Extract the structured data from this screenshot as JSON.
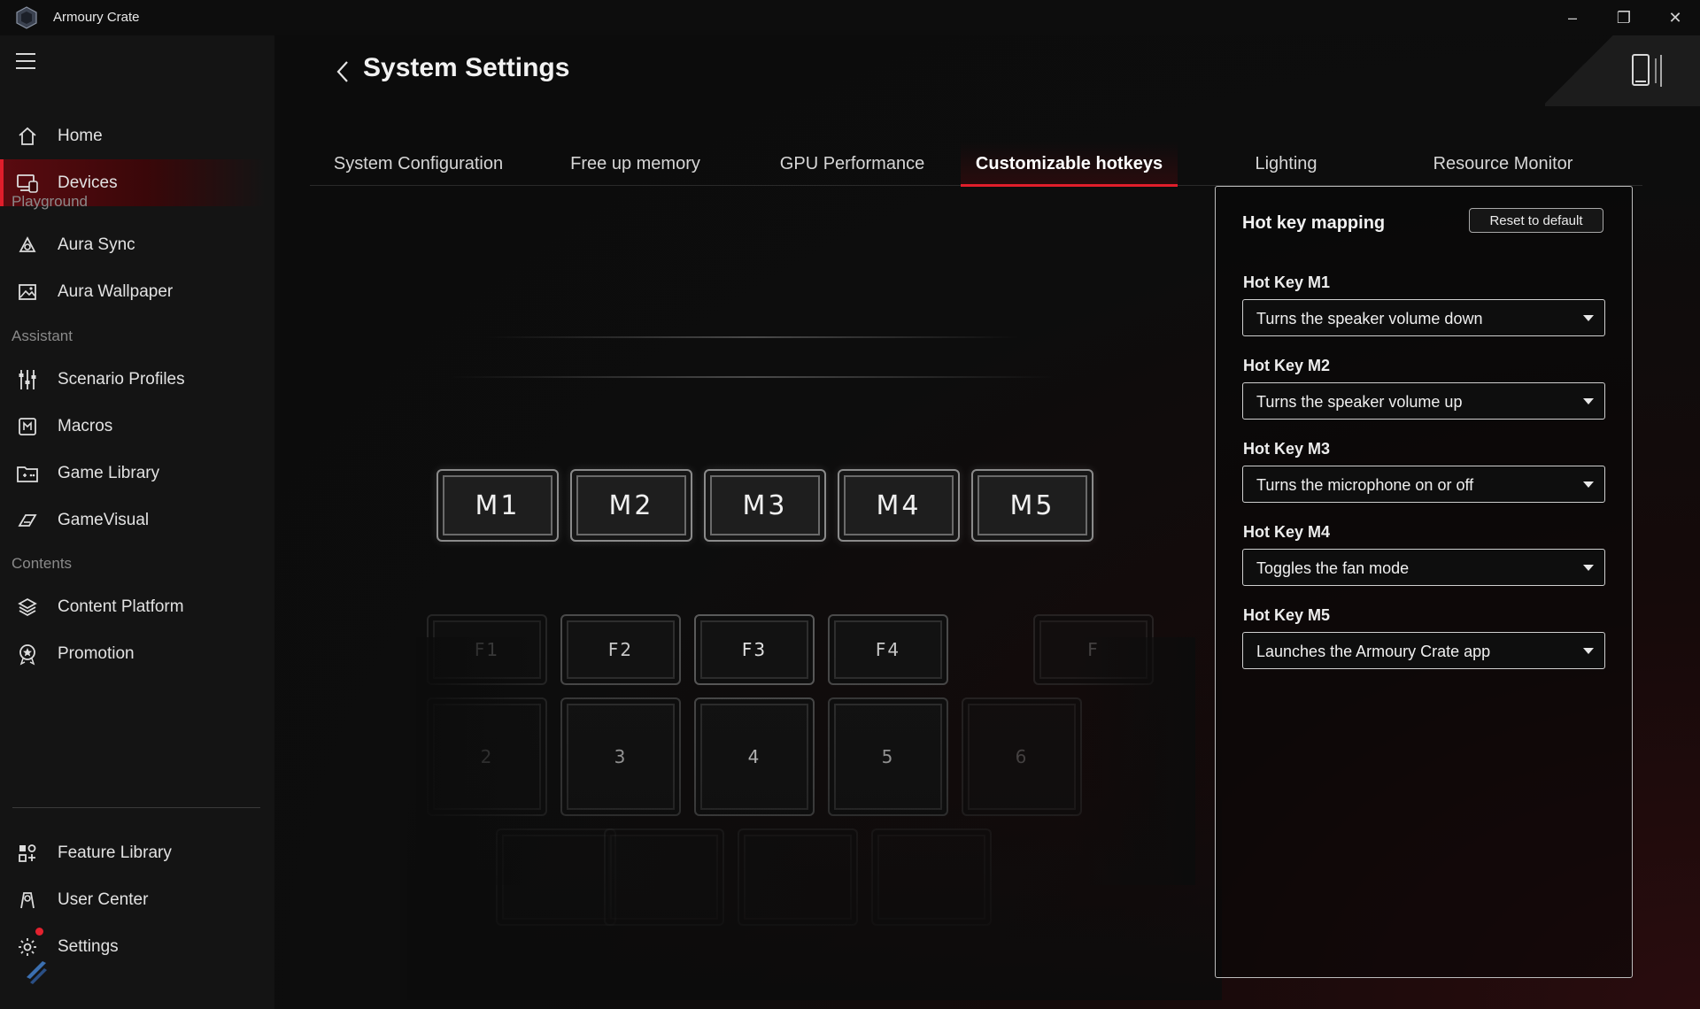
{
  "window": {
    "title": "Armoury Crate",
    "minimize": "–",
    "maximize": "❐",
    "close": "✕"
  },
  "sidebar": {
    "items": [
      {
        "label": "Home",
        "icon": "home-icon"
      },
      {
        "label": "Devices",
        "icon": "devices-icon",
        "active": true
      }
    ],
    "sections": {
      "playground": "Playground",
      "assistant": "Assistant",
      "contents": "Contents"
    },
    "playground_items": [
      {
        "label": "Aura Sync",
        "icon": "aura-sync-icon"
      },
      {
        "label": "Aura Wallpaper",
        "icon": "wallpaper-icon"
      }
    ],
    "assistant_items": [
      {
        "label": "Scenario Profiles",
        "icon": "sliders-icon"
      },
      {
        "label": "Macros",
        "icon": "macro-icon"
      },
      {
        "label": "Game Library",
        "icon": "game-library-icon"
      },
      {
        "label": "GameVisual",
        "icon": "gamevisual-icon"
      }
    ],
    "contents_items": [
      {
        "label": "Content Platform",
        "icon": "layers-icon"
      },
      {
        "label": "Promotion",
        "icon": "promotion-icon"
      }
    ],
    "bottom_items": [
      {
        "label": "Feature Library",
        "icon": "feature-library-icon"
      },
      {
        "label": "User Center",
        "icon": "user-center-icon"
      },
      {
        "label": "Settings",
        "icon": "gear-icon"
      }
    ]
  },
  "main": {
    "title": "System Settings",
    "tabs": [
      {
        "label": "System Configuration"
      },
      {
        "label": "Free up memory"
      },
      {
        "label": "GPU Performance"
      },
      {
        "label": "Customizable hotkeys",
        "active": true
      },
      {
        "label": "Lighting"
      },
      {
        "label": "Resource Monitor"
      }
    ]
  },
  "keyboard": {
    "m_keys": [
      "M1",
      "M2",
      "M3",
      "M4",
      "M5"
    ],
    "f_keys": [
      "F1",
      "F2",
      "F3",
      "F4",
      "F"
    ],
    "num_keys": [
      "2",
      "3",
      "4",
      "5",
      "6"
    ]
  },
  "hotkeys": {
    "title": "Hot key mapping",
    "reset_label": "Reset to default",
    "items": [
      {
        "label": "Hot Key M1",
        "value": "Turns the speaker volume down"
      },
      {
        "label": "Hot Key M2",
        "value": "Turns the speaker volume up"
      },
      {
        "label": "Hot Key M3",
        "value": "Turns the microphone on or off"
      },
      {
        "label": "Hot Key M4",
        "value": "Toggles the fan mode"
      },
      {
        "label": "Hot Key M5",
        "value": "Launches the Armoury Crate app"
      }
    ]
  },
  "colors": {
    "accent": "#e01e2b",
    "background": "#0a0a0a",
    "sidebar": "#141414"
  }
}
